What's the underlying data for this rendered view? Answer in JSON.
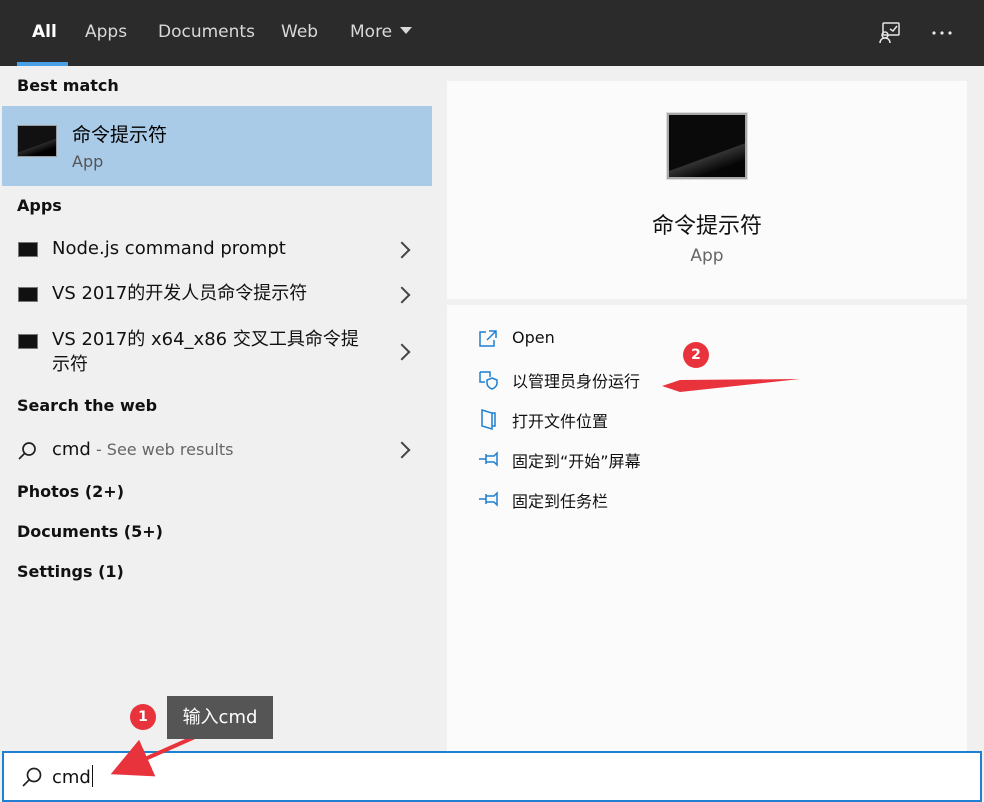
{
  "tabs": [
    {
      "label": "All"
    },
    {
      "label": "Apps"
    },
    {
      "label": "Documents"
    },
    {
      "label": "Web"
    },
    {
      "label": "More"
    }
  ],
  "icons": {
    "feedback": "feedback-icon",
    "more": "ellipsis-icon",
    "search": "search-icon",
    "chevron": "chevron-right-icon"
  },
  "colors": {
    "accent": "#4aa0e6",
    "selected_bg": "#a9cbe8",
    "topbar_bg": "#2b2b2b",
    "annotation_red": "#e8323c"
  },
  "left": {
    "best_match_heading": "Best match",
    "best_match": {
      "title": "命令提示符",
      "subtitle": "App"
    },
    "apps_heading": "Apps",
    "apps": [
      {
        "label": "Node.js command prompt"
      },
      {
        "label": "VS 2017的开发人员命令提示符"
      },
      {
        "label": "VS 2017的 x64_x86 交叉工具命令提示符"
      }
    ],
    "web_heading": "Search the web",
    "web": {
      "query": "cmd",
      "suffix": " - See web results"
    },
    "photos": "Photos (2+)",
    "documents": "Documents (5+)",
    "settings": "Settings (1)"
  },
  "detail": {
    "title": "命令提示符",
    "subtitle": "App",
    "actions": [
      {
        "label": "Open",
        "icon": "open-icon"
      },
      {
        "label": "以管理员身份运行",
        "icon": "shield-icon"
      },
      {
        "label": "打开文件位置",
        "icon": "file-location-icon"
      },
      {
        "label": "固定到“开始”屏幕",
        "icon": "pin-icon"
      },
      {
        "label": "固定到任务栏",
        "icon": "pin-icon"
      }
    ]
  },
  "search": {
    "value": "cmd"
  },
  "annotations": {
    "badge1": "1",
    "badge2": "2",
    "tooltip": "输入cmd"
  }
}
